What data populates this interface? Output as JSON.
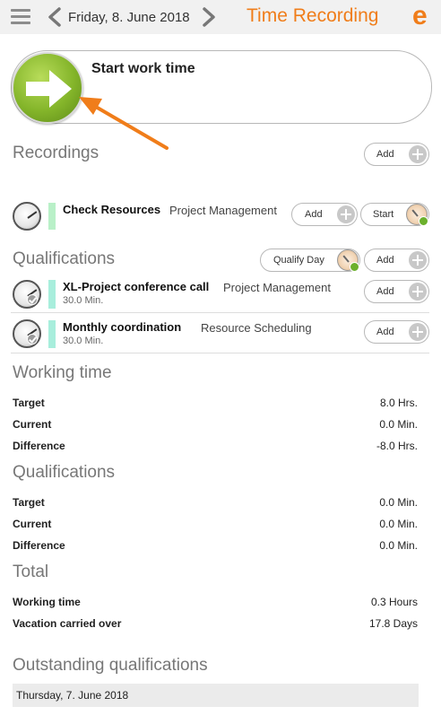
{
  "header": {
    "date": "Friday, 8. June 2018",
    "title": "Time Recording",
    "logo_letter": "e",
    "hamburger_icon": "menu-icon",
    "prev_icon": "chevron-left-icon",
    "next_icon": "chevron-right-icon"
  },
  "start_work": {
    "label": "Start work time",
    "icon": "arrow-right-icon"
  },
  "recordings": {
    "title": "Recordings",
    "add_label": "Add",
    "items": [
      {
        "title": "Check Resources",
        "category": "Project Management",
        "add_label": "Add",
        "start_label": "Start"
      }
    ]
  },
  "qualifications": {
    "title": "Qualifications",
    "qualify_day_label": "Qualify Day",
    "add_label": "Add",
    "items": [
      {
        "title": "XL-Project conference call",
        "category": "Project Management",
        "duration": "30.0 Min.",
        "add_label": "Add"
      },
      {
        "title": "Monthly coordination",
        "category": "Resource Scheduling",
        "duration": "30.0 Min.",
        "add_label": "Add"
      }
    ]
  },
  "working_time": {
    "title": "Working time",
    "rows": [
      {
        "label": "Target",
        "value": "8.0 Hrs."
      },
      {
        "label": "Current",
        "value": "0.0 Min."
      },
      {
        "label": "Difference",
        "value": "-8.0 Hrs."
      }
    ]
  },
  "qualifications_summary": {
    "title": "Qualifications",
    "rows": [
      {
        "label": "Target",
        "value": "0.0 Min."
      },
      {
        "label": "Current",
        "value": "0.0 Min."
      },
      {
        "label": "Difference",
        "value": "0.0 Min."
      }
    ]
  },
  "total": {
    "title": "Total",
    "rows": [
      {
        "label": "Working time",
        "value": "0.3 Hours"
      },
      {
        "label": "Vacation carried over",
        "value": "17.8 Days"
      }
    ]
  },
  "outstanding": {
    "title": "Outstanding qualifications",
    "items": [
      {
        "date": "Thursday, 7. June 2018"
      }
    ]
  },
  "colors": {
    "accent": "#f07d1a",
    "start_green": "#84b52a",
    "recording_bar": "#b9f0c8",
    "qualification_bar": "#a8eedc"
  }
}
